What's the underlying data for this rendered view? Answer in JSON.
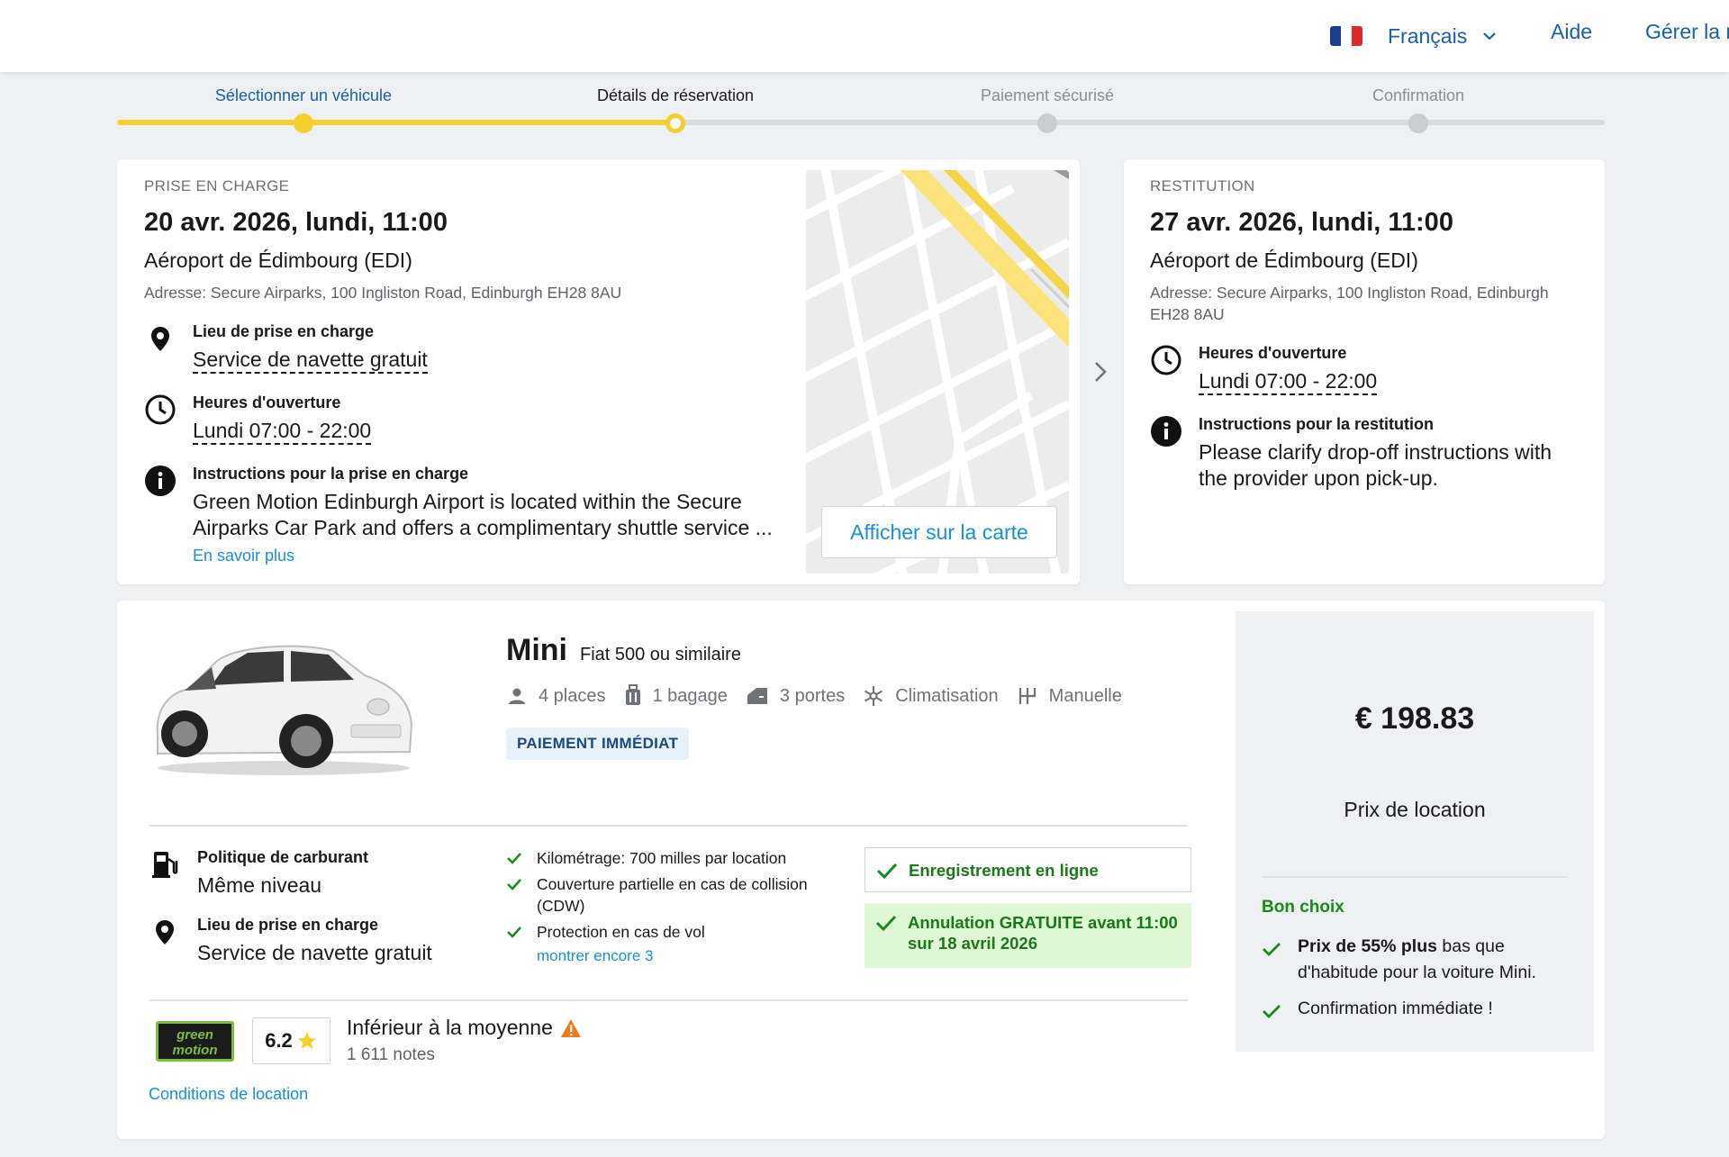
{
  "header": {
    "language": "Français",
    "help": "Aide",
    "manage": "Gérer la r",
    "colors": {
      "flag_blue": "#1c3f95",
      "flag_white": "#ffffff",
      "flag_red": "#e0262e"
    }
  },
  "stepper": {
    "steps": [
      {
        "label": "Sélectionner un véhicule",
        "state": "done"
      },
      {
        "label": "Détails de réservation",
        "state": "current"
      },
      {
        "label": "Paiement sécurisé",
        "state": "upcoming"
      },
      {
        "label": "Confirmation",
        "state": "upcoming"
      }
    ],
    "progress": 0.375,
    "accent": "#f5cf2e"
  },
  "pickup": {
    "overline": "PRISE EN CHARGE",
    "date": "20 avr. 2026, lundi, 11:00",
    "location": "Aéroport de Édimbourg (EDI)",
    "address": "Adresse: Secure Airparks, 100 Ingliston Road, Edinburgh EH28 8AU",
    "place_title": "Lieu de prise en charge",
    "place_value": "Service de navette gratuit",
    "hours_title": "Heures d'ouverture",
    "hours_value": "Lundi 07:00 - 22:00",
    "instr_title": "Instructions pour la prise en charge",
    "instr_line1": "Green Motion Edinburgh Airport is located within the Secure",
    "instr_line2": "Airparks Car Park and offers a complimentary shuttle service ...",
    "learn_more": "En savoir plus",
    "map_button": "Afficher sur la carte"
  },
  "dropoff": {
    "overline": "RESTITUTION",
    "date": "27 avr. 2026, lundi, 11:00",
    "location": "Aéroport de Édimbourg (EDI)",
    "address_line1": "Adresse: Secure Airparks, 100 Ingliston Road, Edinburgh",
    "address_line2": "EH28 8AU",
    "hours_title": "Heures d'ouverture",
    "hours_value": "Lundi 07:00 - 22:00",
    "instr_title": "Instructions pour la restitution",
    "instr_line1": "Please clarify drop-off instructions with",
    "instr_line2": "the provider upon pick-up."
  },
  "car": {
    "category": "Mini",
    "model": "Fiat 500 ou similaire",
    "features": {
      "seats": "4 places",
      "bags": "1 bagage",
      "doors": "3 portes",
      "ac": "Climatisation",
      "transmission": "Manuelle"
    },
    "payment_badge": "PAIEMENT IMMÉDIAT",
    "fuel_title": "Politique de carburant",
    "fuel_value": "Même niveau",
    "place_title": "Lieu de prise en charge",
    "place_value": "Service de navette gratuit",
    "inclusions": [
      "Kilométrage: 700 milles par location",
      "Couverture partielle en cas de collision (CDW)",
      "Protection en cas de vol"
    ],
    "show_more": "montrer encore 3",
    "checkin": "Enregistrement en ligne",
    "cancel_line1": "Annulation GRATUITE avant 11:00",
    "cancel_line2": "sur 18 avril 2026",
    "supplier_logo_text": "green motion",
    "rating": "6.2",
    "rating_label": "Inférieur à la moyenne",
    "rating_count": "1 611 notes",
    "conditions": "Conditions de location"
  },
  "price": {
    "amount": "€ 198.83",
    "label": "Prix de location",
    "good_title": "Bon choix",
    "good_item1_bold": "Prix de 55% plus",
    "good_item1_rest": " bas que d'habitude pour la voiture Mini.",
    "good_item2": "Confirmation immédiate !"
  }
}
